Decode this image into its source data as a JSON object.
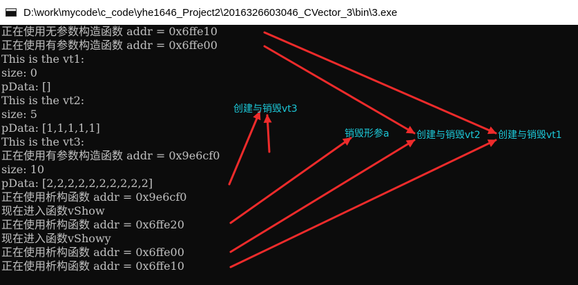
{
  "window": {
    "title": "D:\\work\\mycode\\c_code\\yhe1646_Project2\\2016326603046_CVector_3\\bin\\3.exe"
  },
  "console": {
    "lines": [
      "正在使用无参数构造函数 addr = 0x6ffe10",
      "正在使用有参数构造函数 addr = 0x6ffe00",
      "This is the vt1:",
      "size: 0",
      "pData: []",
      "This is the vt2:",
      "size: 5",
      "pData: [1,1,1,1,1]",
      "This is the vt3:",
      "正在使用有参数构造函数 addr = 0x9e6cf0",
      "size: 10",
      "pData: [2,2,2,2,2,2,2,2,2,2]",
      "正在使用析构函数 addr = 0x9e6cf0",
      "现在进入函数vShow",
      "正在使用析构函数 addr = 0x6ffe20",
      "现在进入函数vShowy",
      "正在使用析构函数 addr = 0x6ffe00",
      "正在使用析构函数 addr = 0x6ffe10"
    ]
  },
  "annotations": {
    "vt3": "创建与销毁vt3",
    "param_a": "销毁形参a",
    "vt2": "创建与销毁vt2",
    "vt1": "创建与销毁vt1"
  },
  "colors": {
    "background": "#0c0c0c",
    "text": "#c0c0c0",
    "annotation": "#1cc8d8",
    "arrow": "#ee2b2b"
  }
}
